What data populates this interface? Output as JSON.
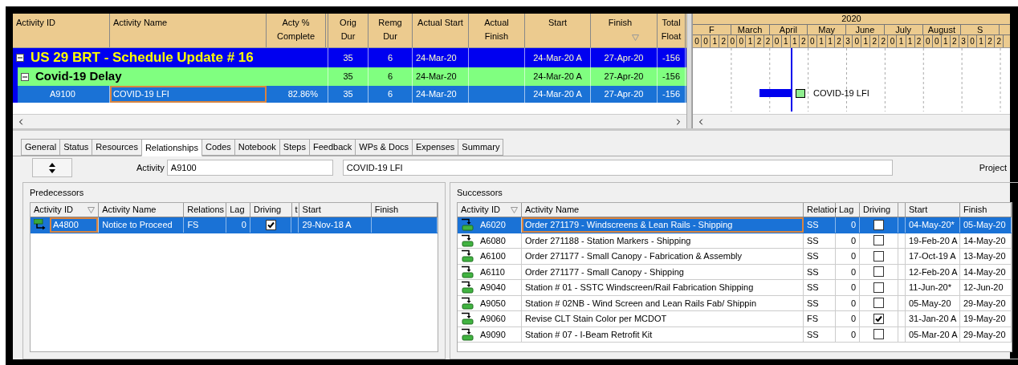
{
  "activity_table": {
    "columns": [
      "Activity ID",
      "Activity Name",
      "Acty % Complete",
      "Orig Dur",
      "Remg Dur",
      "Actual Start",
      "Actual Finish",
      "Start",
      "Finish",
      "Total Float"
    ],
    "rows": [
      {
        "kind": "project",
        "expanded": true,
        "selected": false,
        "name": "US 29 BRT - Schedule Update # 16",
        "orig_dur": "35",
        "remg_dur": "6",
        "actual_start": "24-Mar-20",
        "start": "24-Mar-20 A",
        "finish": "27-Apr-20",
        "total_float": "-156"
      },
      {
        "kind": "wbs",
        "expanded": true,
        "selected": false,
        "name": "Covid-19 Delay",
        "orig_dur": "35",
        "remg_dur": "6",
        "actual_start": "24-Mar-20",
        "start": "24-Mar-20 A",
        "finish": "27-Apr-20",
        "total_float": "-156"
      },
      {
        "kind": "activity",
        "selected": true,
        "name_focused": true,
        "id": "A9100",
        "name": "COVID-19 LFI",
        "pct_complete": "82.86%",
        "orig_dur": "35",
        "remg_dur": "6",
        "actual_start": "24-Mar-20",
        "start": "24-Mar-20 A",
        "finish": "27-Apr-20",
        "total_float": "-156"
      }
    ]
  },
  "gantt": {
    "year": "2020",
    "months": [
      "F",
      "March",
      "April",
      "May",
      "June",
      "July",
      "August",
      "S"
    ],
    "weeks": [
      "0",
      "0",
      "1",
      "2",
      "0",
      "0",
      "1",
      "2",
      "2",
      "0",
      "1",
      "1",
      "2",
      "0",
      "1",
      "1",
      "2",
      "3",
      "0",
      "1",
      "2",
      "2",
      "0",
      "1",
      "1",
      "2",
      "0",
      "0",
      "1",
      "2",
      "3",
      "0",
      "1",
      "2",
      "2"
    ],
    "bar_label": "COVID-19 LFI"
  },
  "tabs": [
    {
      "label": "General",
      "selected": false
    },
    {
      "label": "Status",
      "selected": false
    },
    {
      "label": "Resources",
      "selected": false
    },
    {
      "label": "Relationships",
      "selected": true
    },
    {
      "label": "Codes",
      "selected": false
    },
    {
      "label": "Notebook",
      "selected": false
    },
    {
      "label": "Steps",
      "selected": false
    },
    {
      "label": "Feedback",
      "selected": false
    },
    {
      "label": "WPs & Docs",
      "selected": false
    },
    {
      "label": "Expenses",
      "selected": false
    },
    {
      "label": "Summary",
      "selected": false
    }
  ],
  "detail": {
    "activity_label": "Activity",
    "activity_id": "A9100",
    "activity_name": "COVID-19 LFI",
    "project_label": "Project"
  },
  "predecessors": {
    "title": "Predecessors",
    "columns": [
      "Activity ID",
      "Activity Name",
      "Relations",
      "Lag",
      "Driving",
      "t",
      "Start",
      "Finish"
    ],
    "rows": [
      {
        "selected": true,
        "id_focused": true,
        "id": "A4800",
        "name": "Notice to Proceed",
        "relation": "FS",
        "lag": "0",
        "driving": true,
        "start": "29-Nov-18 A"
      }
    ]
  },
  "successors": {
    "title": "Successors",
    "columns": [
      "Activity ID",
      "Activity Name",
      "Relatior",
      "Lag",
      "Driving",
      "Start",
      "Finish"
    ],
    "rows": [
      {
        "selected": true,
        "name_focused": true,
        "id": "A6020",
        "name": "Order 271179 - Windscreens & Lean Rails - Shipping",
        "relation": "SS",
        "lag": "0",
        "driving": false,
        "start": "04-May-20*",
        "finish": "05-May-20"
      },
      {
        "selected": false,
        "id": "A6080",
        "name": "Order 271188 - Station Markers - Shipping",
        "relation": "SS",
        "lag": "0",
        "driving": false,
        "start": "19-Feb-20 A",
        "finish": "14-May-20"
      },
      {
        "selected": false,
        "id": "A6100",
        "name": "Order 271177 - Small Canopy - Fabrication & Assembly",
        "relation": "SS",
        "lag": "0",
        "driving": false,
        "start": "17-Oct-19 A",
        "finish": "13-May-20"
      },
      {
        "selected": false,
        "id": "A6110",
        "name": "Order 271177 - Small Canopy - Shipping",
        "relation": "SS",
        "lag": "0",
        "driving": false,
        "start": "12-Feb-20 A",
        "finish": "14-May-20"
      },
      {
        "selected": false,
        "id": "A9040",
        "name": "Station # 01 - SSTC Windscreen/Rail Fabrication Shipping",
        "relation": "SS",
        "lag": "0",
        "driving": false,
        "start": "11-Jun-20*",
        "finish": "12-Jun-20"
      },
      {
        "selected": false,
        "id": "A9050",
        "name": "Station # 02NB - Wind Screen and Lean Rails Fab/ Shippin",
        "relation": "SS",
        "lag": "0",
        "driving": false,
        "start": "05-May-20",
        "finish": "29-May-20"
      },
      {
        "selected": false,
        "id": "A9060",
        "name": "Revise CLT Stain Color per MCDOT",
        "relation": "FS",
        "lag": "0",
        "driving": true,
        "start": "31-Jan-20 A",
        "finish": "19-May-20"
      },
      {
        "selected": false,
        "id": "A9090",
        "name": "Station # 07 - I-Beam Retrofit Kit",
        "relation": "SS",
        "lag": "0",
        "driving": false,
        "start": "05-Mar-20 A",
        "finish": "29-May-20"
      }
    ]
  }
}
